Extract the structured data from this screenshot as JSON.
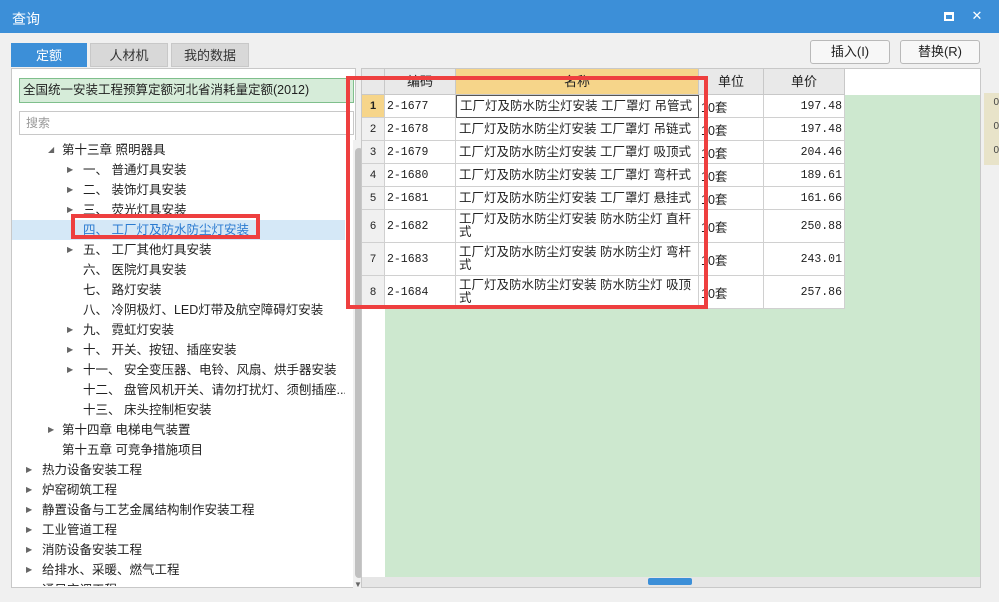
{
  "window": {
    "title": "查询",
    "maximize": "□",
    "close": "✕"
  },
  "tabs": [
    {
      "label": "定额",
      "active": true
    },
    {
      "label": "人材机",
      "active": false
    },
    {
      "label": "我的数据",
      "active": false
    }
  ],
  "actions": {
    "insert": "插入(I)",
    "replace": "替换(R)"
  },
  "quota_library": "全国统一安装工程预算定额河北省消耗量定额(2012)",
  "search": {
    "placeholder": "搜索",
    "value": ""
  },
  "tree": [
    {
      "label": "第十三章 照明器具",
      "arrow": "◢",
      "expanded": true
    },
    {
      "label": "一、 普通灯具安装",
      "arrow": "▶"
    },
    {
      "label": "二、 装饰灯具安装",
      "arrow": "▶"
    },
    {
      "label": "三、 荧光灯具安装",
      "arrow": "▶"
    },
    {
      "label": "四、 工厂灯及防水防尘灯安装",
      "arrow": "",
      "selected": true
    },
    {
      "label": "五、 工厂其他灯具安装",
      "arrow": "▶"
    },
    {
      "label": "六、 医院灯具安装",
      "arrow": ""
    },
    {
      "label": "七、 路灯安装",
      "arrow": ""
    },
    {
      "label": "八、 冷阴极灯、LED灯带及航空障碍灯安装",
      "arrow": ""
    },
    {
      "label": "九、 霓虹灯安装",
      "arrow": "▶"
    },
    {
      "label": "十、 开关、按钮、插座安装",
      "arrow": "▶"
    },
    {
      "label": "十一、 安全变压器、电铃、风扇、烘手器安装",
      "arrow": "▶"
    },
    {
      "label": "十二、 盘管风机开关、请勿打扰灯、须刨插座...",
      "arrow": ""
    },
    {
      "label": "十三、 床头控制柜安装",
      "arrow": ""
    },
    {
      "label": "第十四章 电梯电气装置",
      "arrow": "▶"
    },
    {
      "label": "第十五章 可竞争措施项目",
      "arrow": ""
    },
    {
      "label": "热力设备安装工程",
      "arrow": "▶"
    },
    {
      "label": "炉窑砌筑工程",
      "arrow": "▶"
    },
    {
      "label": "静置设备与工艺金属结构制作安装工程",
      "arrow": "▶"
    },
    {
      "label": "工业管道工程",
      "arrow": "▶"
    },
    {
      "label": "消防设备安装工程",
      "arrow": "▶"
    },
    {
      "label": "给排水、采暖、燃气工程",
      "arrow": "▶"
    },
    {
      "label": "通风空调工程",
      "arrow": "▶"
    }
  ],
  "grid": {
    "columns": [
      "编码",
      "名称",
      "单位",
      "单价"
    ],
    "rows": [
      {
        "idx": "1",
        "code": "2-1677",
        "name": "工厂灯及防水防尘灯安装 工厂罩灯 吊管式",
        "unit": "10套",
        "price": "197.48"
      },
      {
        "idx": "2",
        "code": "2-1678",
        "name": "工厂灯及防水防尘灯安装 工厂罩灯 吊链式",
        "unit": "10套",
        "price": "197.48"
      },
      {
        "idx": "3",
        "code": "2-1679",
        "name": "工厂灯及防水防尘灯安装 工厂罩灯 吸顶式",
        "unit": "10套",
        "price": "204.46"
      },
      {
        "idx": "4",
        "code": "2-1680",
        "name": "工厂灯及防水防尘灯安装 工厂罩灯 弯杆式",
        "unit": "10套",
        "price": "189.61"
      },
      {
        "idx": "5",
        "code": "2-1681",
        "name": "工厂灯及防水防尘灯安装 工厂罩灯 悬挂式",
        "unit": "10套",
        "price": "161.66"
      },
      {
        "idx": "6",
        "code": "2-1682",
        "name": "工厂灯及防水防尘灯安装 防水防尘灯 直杆式",
        "unit": "10套",
        "price": "250.88"
      },
      {
        "idx": "7",
        "code": "2-1683",
        "name": "工厂灯及防水防尘灯安装 防水防尘灯 弯杆式",
        "unit": "10套",
        "price": "243.01"
      },
      {
        "idx": "8",
        "code": "2-1684",
        "name": "工厂灯及防水防尘灯安装 防水防尘灯 吸顶式",
        "unit": "10套",
        "price": "257.86"
      }
    ]
  },
  "edge_numbers": [
    "0",
    "0",
    "0"
  ],
  "colors": {
    "accent": "#3c8fd8",
    "highlight": "#ee3f3f",
    "grid_bg": "#cde8cf"
  }
}
